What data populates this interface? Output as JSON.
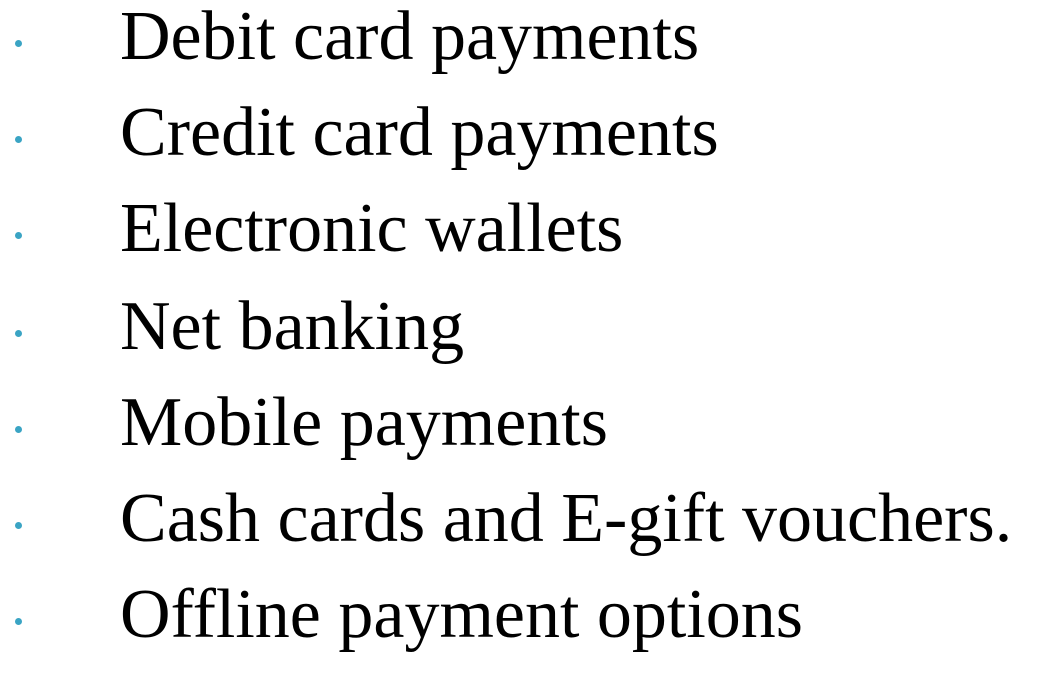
{
  "bullets": [
    {
      "label": "Debit card payments"
    },
    {
      "label": "Credit card payments"
    },
    {
      "label": "Electronic wallets"
    },
    {
      "label": "Net banking"
    },
    {
      "label": "Mobile payments"
    },
    {
      "label": "Cash cards and E-gift vouchers."
    },
    {
      "label": "Offline payment options"
    }
  ],
  "colors": {
    "bullet": "#3aa4c4",
    "text": "#000000",
    "background": "#ffffff"
  }
}
